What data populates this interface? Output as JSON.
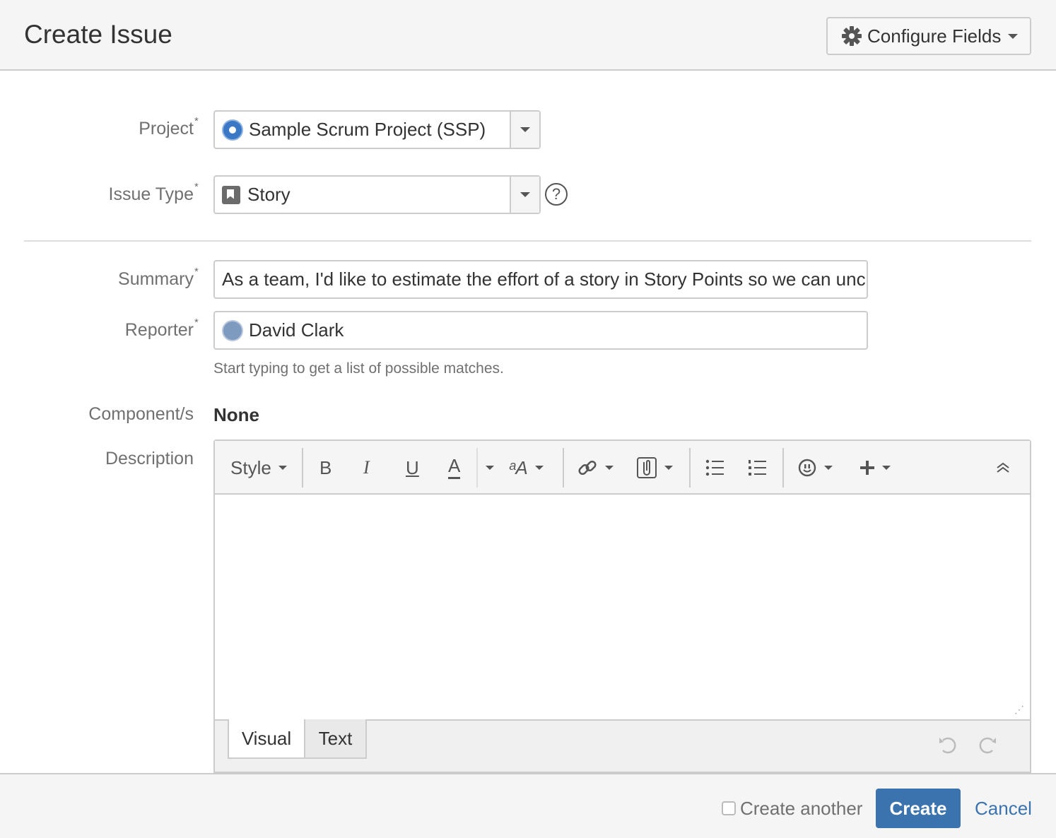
{
  "dialog": {
    "title": "Create Issue",
    "configure_fields_label": "Configure Fields"
  },
  "fields": {
    "project": {
      "label": "Project",
      "required_mark": "*",
      "value": "Sample Scrum Project (SSP)"
    },
    "issue_type": {
      "label": "Issue Type",
      "required_mark": "*",
      "value": "Story"
    },
    "summary": {
      "label": "Summary",
      "required_mark": "*",
      "value": "As a team, I'd like to estimate the effort of a story in Story Points so we can unc"
    },
    "reporter": {
      "label": "Reporter",
      "required_mark": "*",
      "value": "David Clark",
      "hint": "Start typing to get a list of possible matches."
    },
    "components": {
      "label": "Component/s",
      "value": "None"
    },
    "description": {
      "label": "Description"
    }
  },
  "editor": {
    "style_label": "Style",
    "bold": "B",
    "italic": "I",
    "underline": "U",
    "text_color": "A",
    "text_effects": "ᵃA",
    "tabs": [
      "Visual",
      "Text"
    ],
    "active_tab": "Visual"
  },
  "footer": {
    "create_another_label": "Create another",
    "create_another_checked": false,
    "create_label": "Create",
    "cancel_label": "Cancel"
  },
  "colors": {
    "primary": "#3b73af",
    "header_bg": "#f5f5f5",
    "border": "#cccccc"
  },
  "icons": [
    "gear-icon",
    "chevron-down-icon",
    "project-avatar-icon",
    "story-icon",
    "help-icon",
    "user-avatar-icon",
    "link-icon",
    "attachment-icon",
    "bullet-list-icon",
    "numbered-list-icon",
    "emoji-icon",
    "plus-icon",
    "collapse-icon",
    "undo-icon",
    "redo-icon"
  ]
}
